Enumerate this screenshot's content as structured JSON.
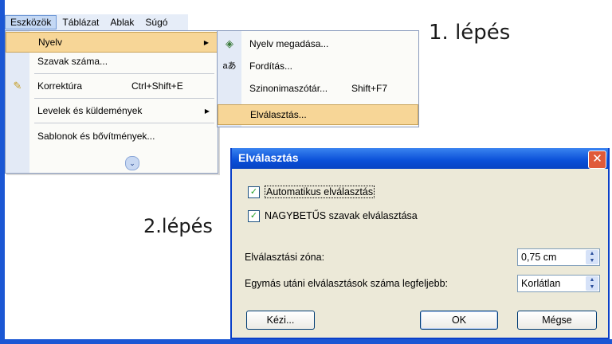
{
  "menubar": {
    "items": [
      {
        "label": "Eszközök"
      },
      {
        "label": "Táblázat"
      },
      {
        "label": "Ablak"
      },
      {
        "label": "Súgó"
      }
    ]
  },
  "tools_menu": {
    "items": [
      {
        "label": "Nyelv",
        "shortcut": ""
      },
      {
        "label": "Szavak száma...",
        "shortcut": ""
      },
      {
        "label": "Korrektúra",
        "shortcut": "Ctrl+Shift+E"
      },
      {
        "label": "Levelek és küldemények",
        "shortcut": ""
      },
      {
        "label": "Sablonok és bővítmények...",
        "shortcut": ""
      }
    ]
  },
  "language_submenu": {
    "items": [
      {
        "label": "Nyelv megadása...",
        "shortcut": ""
      },
      {
        "label": "Fordítás...",
        "shortcut": ""
      },
      {
        "label": "Szinonimaszótár...",
        "shortcut": "Shift+F7"
      },
      {
        "label": "Elválasztás...",
        "shortcut": ""
      }
    ]
  },
  "annotations": {
    "step1": "1. lépés",
    "step2": "2.lépés"
  },
  "dialog": {
    "title": "Elválasztás",
    "close_glyph": "✕",
    "auto_hyphenate": {
      "label": "Automatikus elválasztás",
      "checked": true
    },
    "caps_hyphenate": {
      "label": "NAGYBETŰS szavak elválasztása",
      "checked": true
    },
    "zone": {
      "label": "Elválasztási zóna:",
      "value": "0,75 cm"
    },
    "consecutive": {
      "label": "Egymás utáni elválasztások száma legfeljebb:",
      "value": "Korlátlan"
    },
    "buttons": {
      "manual": "Kézi...",
      "ok": "OK",
      "cancel": "Mégse"
    }
  },
  "colors": {
    "highlight": "#f7d697",
    "title_bar": "#0a4fd8",
    "dialog_bg": "#ece9d8"
  }
}
